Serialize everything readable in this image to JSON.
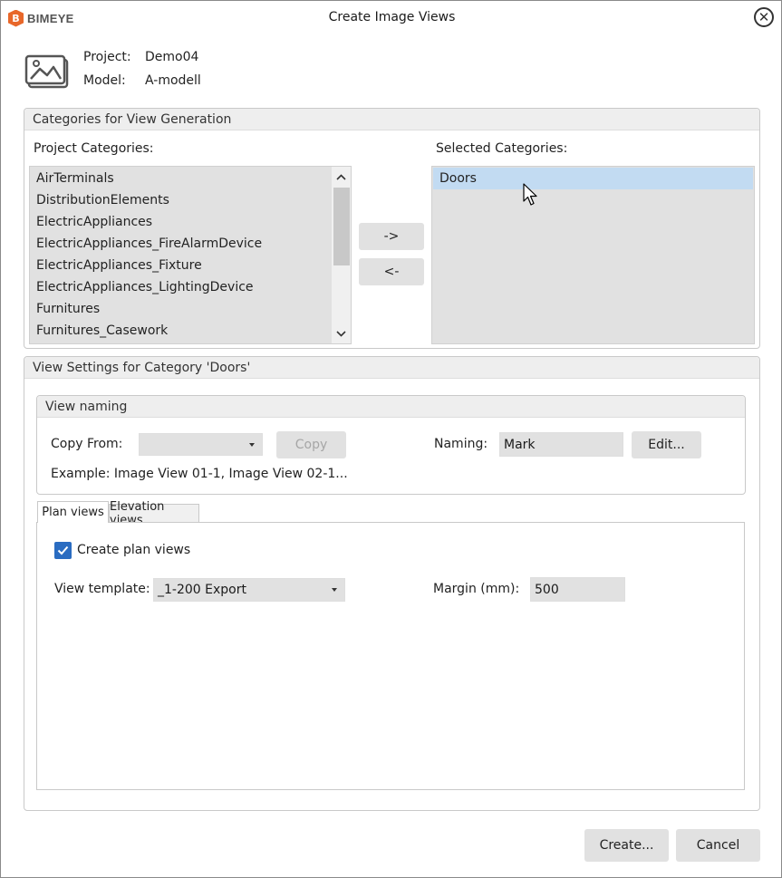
{
  "window": {
    "brand": "BIMEYE",
    "brand_mark": "B",
    "title": "Create Image Views",
    "close_icon": "close-icon"
  },
  "project": {
    "project_label": "Project:",
    "project_value": "Demo04",
    "model_label": "Model:",
    "model_value": "A-modell",
    "icon": "image-views-icon"
  },
  "categories": {
    "group_title": "Categories for View Generation",
    "project_label": "Project Categories:",
    "selected_label": "Selected Categories:",
    "project_items": [
      "AirTerminals",
      "DistributionElements",
      "ElectricAppliances",
      "ElectricAppliances_FireAlarmDevice",
      "ElectricAppliances_Fixture",
      "ElectricAppliances_LightingDevice",
      "Furnitures",
      "Furnitures_Casework"
    ],
    "selected_items": [
      "Doors"
    ],
    "add_button": "->",
    "remove_button": "<-"
  },
  "view_settings": {
    "group_title": "View Settings for Category 'Doors'",
    "naming": {
      "group_title": "View naming",
      "copy_from_label": "Copy From:",
      "copy_from_value": "",
      "copy_button": "Copy",
      "naming_label": "Naming:",
      "naming_value": "Mark",
      "edit_button": "Edit...",
      "example": "Example: Image View 01-1, Image View 02-1..."
    },
    "tabs": [
      "Plan views",
      "Elevation views"
    ],
    "active_tab": "Plan views",
    "plan": {
      "create_label": "Create plan views",
      "create_checked": true,
      "template_label": "View template:",
      "template_value": "_1-200 Export",
      "margin_label": "Margin (mm):",
      "margin_value": "500"
    }
  },
  "footer": {
    "create_button": "Create...",
    "cancel_button": "Cancel"
  },
  "colors": {
    "brand_orange": "#e8672a",
    "selection_blue": "#c2dbf2",
    "checkbox_blue": "#2a6cc1"
  }
}
